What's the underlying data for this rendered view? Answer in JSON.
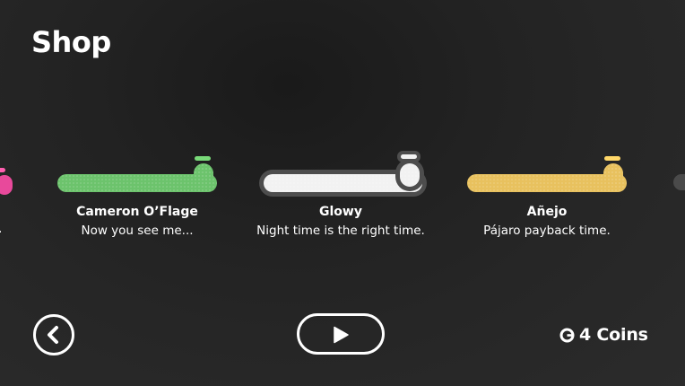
{
  "header": {
    "title": "Shop"
  },
  "items": [
    {
      "name": "Cameron O’Flage",
      "tagline": "Now you see me...",
      "color": "#6cc36c",
      "selected": false
    },
    {
      "name": "Glowy",
      "tagline": "Night time is the right time.",
      "color": "#f2f2f2",
      "selected": true
    },
    {
      "name": "Añejo",
      "tagline": "Pájaro payback time.",
      "color": "#e8c15e",
      "selected": false
    }
  ],
  "edge_left": {
    "color": "#e8499b",
    "text": "."
  },
  "footer": {
    "back_icon": "chevron-left-icon",
    "play_icon": "play-icon",
    "coin_icon": "coin-icon",
    "coins_label": "4 Coins"
  },
  "colors": {
    "background": "#262626",
    "foreground": "#ffffff"
  }
}
